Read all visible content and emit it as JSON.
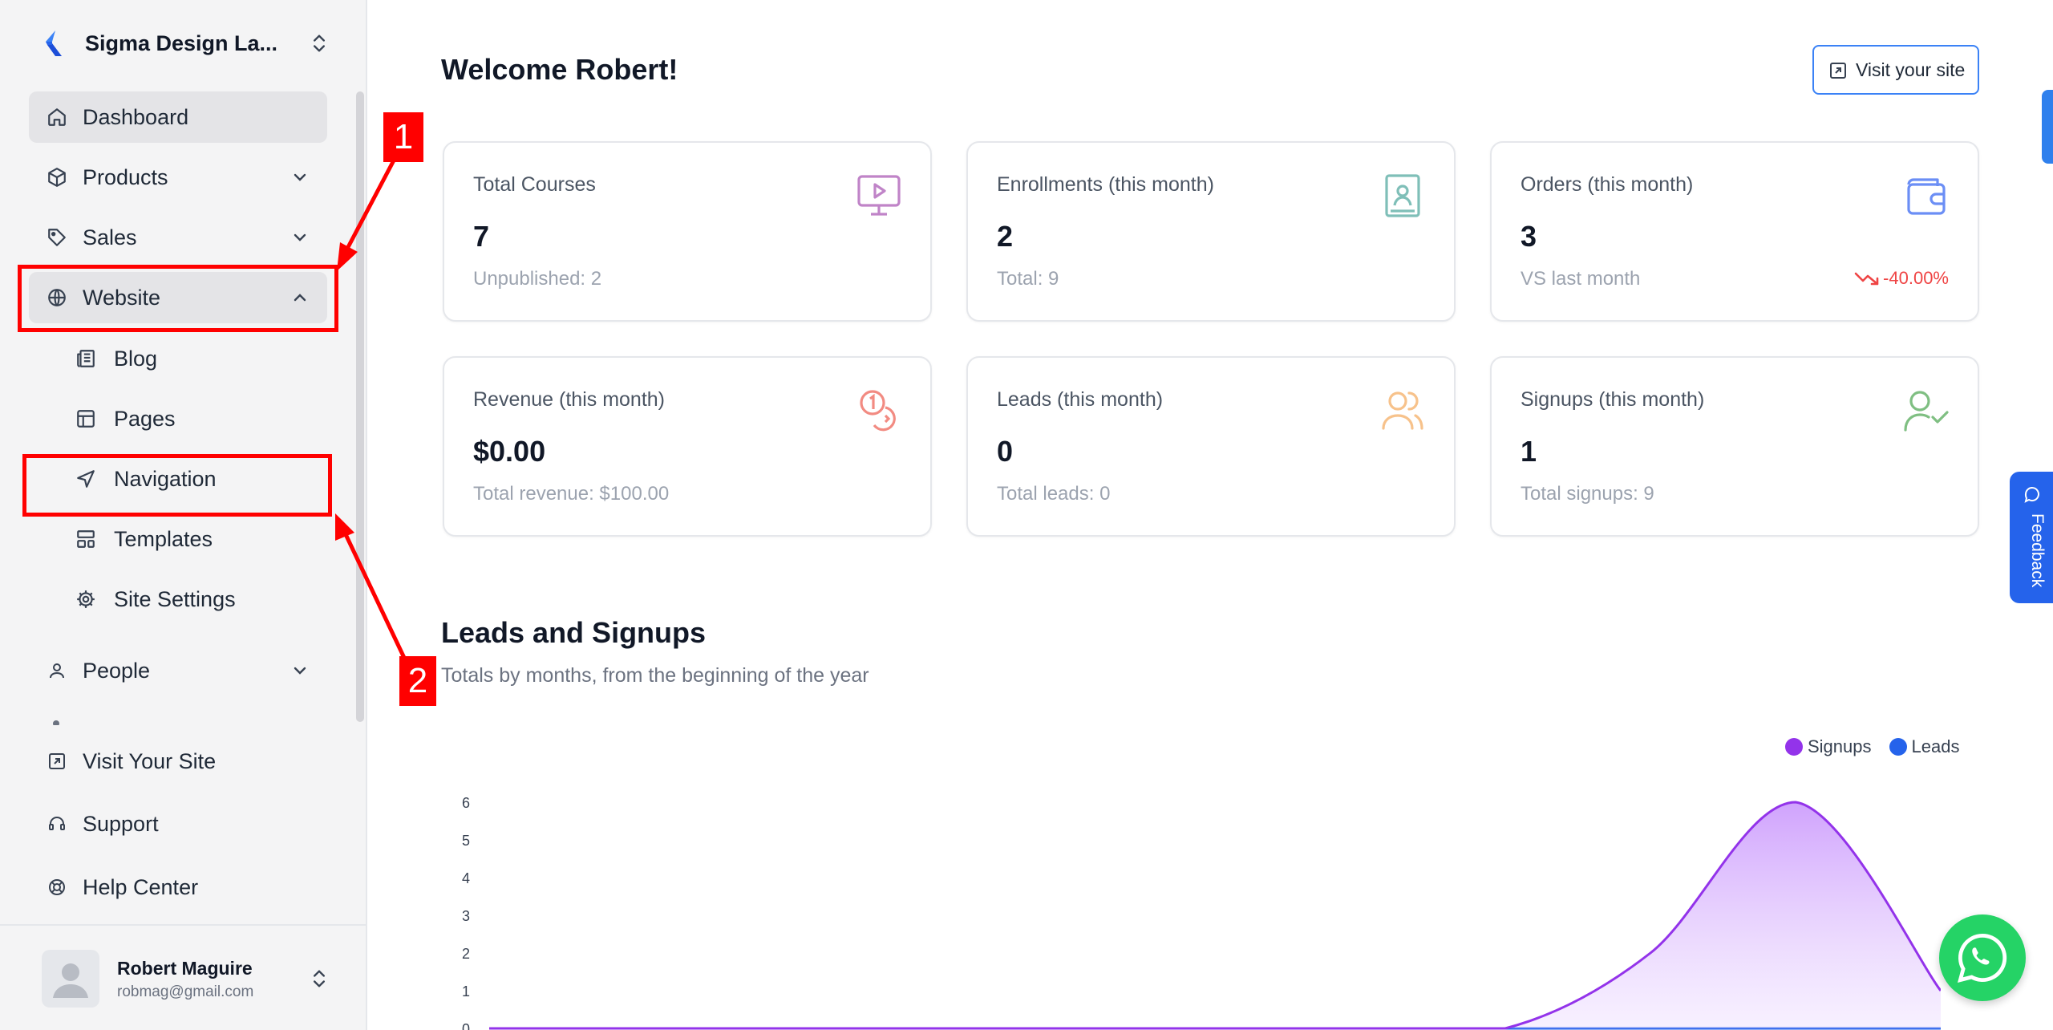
{
  "brand": {
    "name": "Sigma Design La..."
  },
  "sidebar": {
    "items": [
      {
        "label": "Dashboard",
        "icon": "home-icon"
      },
      {
        "label": "Products",
        "icon": "box-icon"
      },
      {
        "label": "Sales",
        "icon": "tag-icon"
      },
      {
        "label": "Website",
        "icon": "globe-icon"
      },
      {
        "label": "People",
        "icon": "user-icon"
      }
    ],
    "website_sub": [
      {
        "label": "Blog",
        "icon": "newspaper-icon"
      },
      {
        "label": "Pages",
        "icon": "layout-icon"
      },
      {
        "label": "Navigation",
        "icon": "navigation-icon"
      },
      {
        "label": "Templates",
        "icon": "templates-icon"
      },
      {
        "label": "Site Settings",
        "icon": "gear-icon"
      }
    ],
    "bottom": [
      {
        "label": "Visit Your Site",
        "icon": "external-link-icon"
      },
      {
        "label": "Support",
        "icon": "headset-icon"
      },
      {
        "label": "Help Center",
        "icon": "lifebuoy-icon"
      }
    ]
  },
  "user": {
    "name": "Robert Maguire",
    "email": "robmag@gmail.com"
  },
  "annotations": {
    "one": "1",
    "two": "2",
    "color": "#ff0000"
  },
  "main": {
    "welcome": "Welcome Robert!",
    "visit_button": "Visit your site",
    "cards": [
      {
        "title": "Total Courses",
        "value": "7",
        "sub": "Unpublished: 2",
        "icon": "monitor-play-icon",
        "color": "#c084c8"
      },
      {
        "title": "Enrollments (this month)",
        "value": "2",
        "sub": "Total: 9",
        "icon": "contact-book-icon",
        "color": "#7fbfb8"
      },
      {
        "title": "Orders (this month)",
        "value": "3",
        "sub": "VS last month",
        "trend": "-40.00%",
        "icon": "wallet-icon",
        "color": "#6b8ef5"
      },
      {
        "title": "Revenue (this month)",
        "value": "$0.00",
        "sub": "Total revenue: $100.00",
        "icon": "coins-icon",
        "color": "#f28b82"
      },
      {
        "title": "Leads (this month)",
        "value": "0",
        "sub": "Total leads: 0",
        "icon": "users-icon",
        "color": "#f7c28b"
      },
      {
        "title": "Signups (this month)",
        "value": "1",
        "sub": "Total signups: 9",
        "icon": "user-check-icon",
        "color": "#7fbf82"
      }
    ],
    "section_title": "Leads and Signups",
    "section_sub": "Totals by months, from the beginning of the year"
  },
  "feedback": {
    "label": "Feedback"
  },
  "chart_data": {
    "type": "area",
    "series": [
      {
        "name": "Signups",
        "color": "#9333ea",
        "values": [
          0,
          0,
          0,
          0,
          0,
          0,
          0,
          0,
          2,
          6,
          1
        ]
      },
      {
        "name": "Leads",
        "color": "#2563eb",
        "values": [
          0,
          0,
          0,
          0,
          0,
          0,
          0,
          0,
          0,
          0,
          0
        ]
      }
    ],
    "y_ticks": [
      "6",
      "5",
      "4",
      "3",
      "2",
      "1",
      "0"
    ],
    "ylim": [
      0,
      6
    ],
    "legend": "top-right"
  }
}
